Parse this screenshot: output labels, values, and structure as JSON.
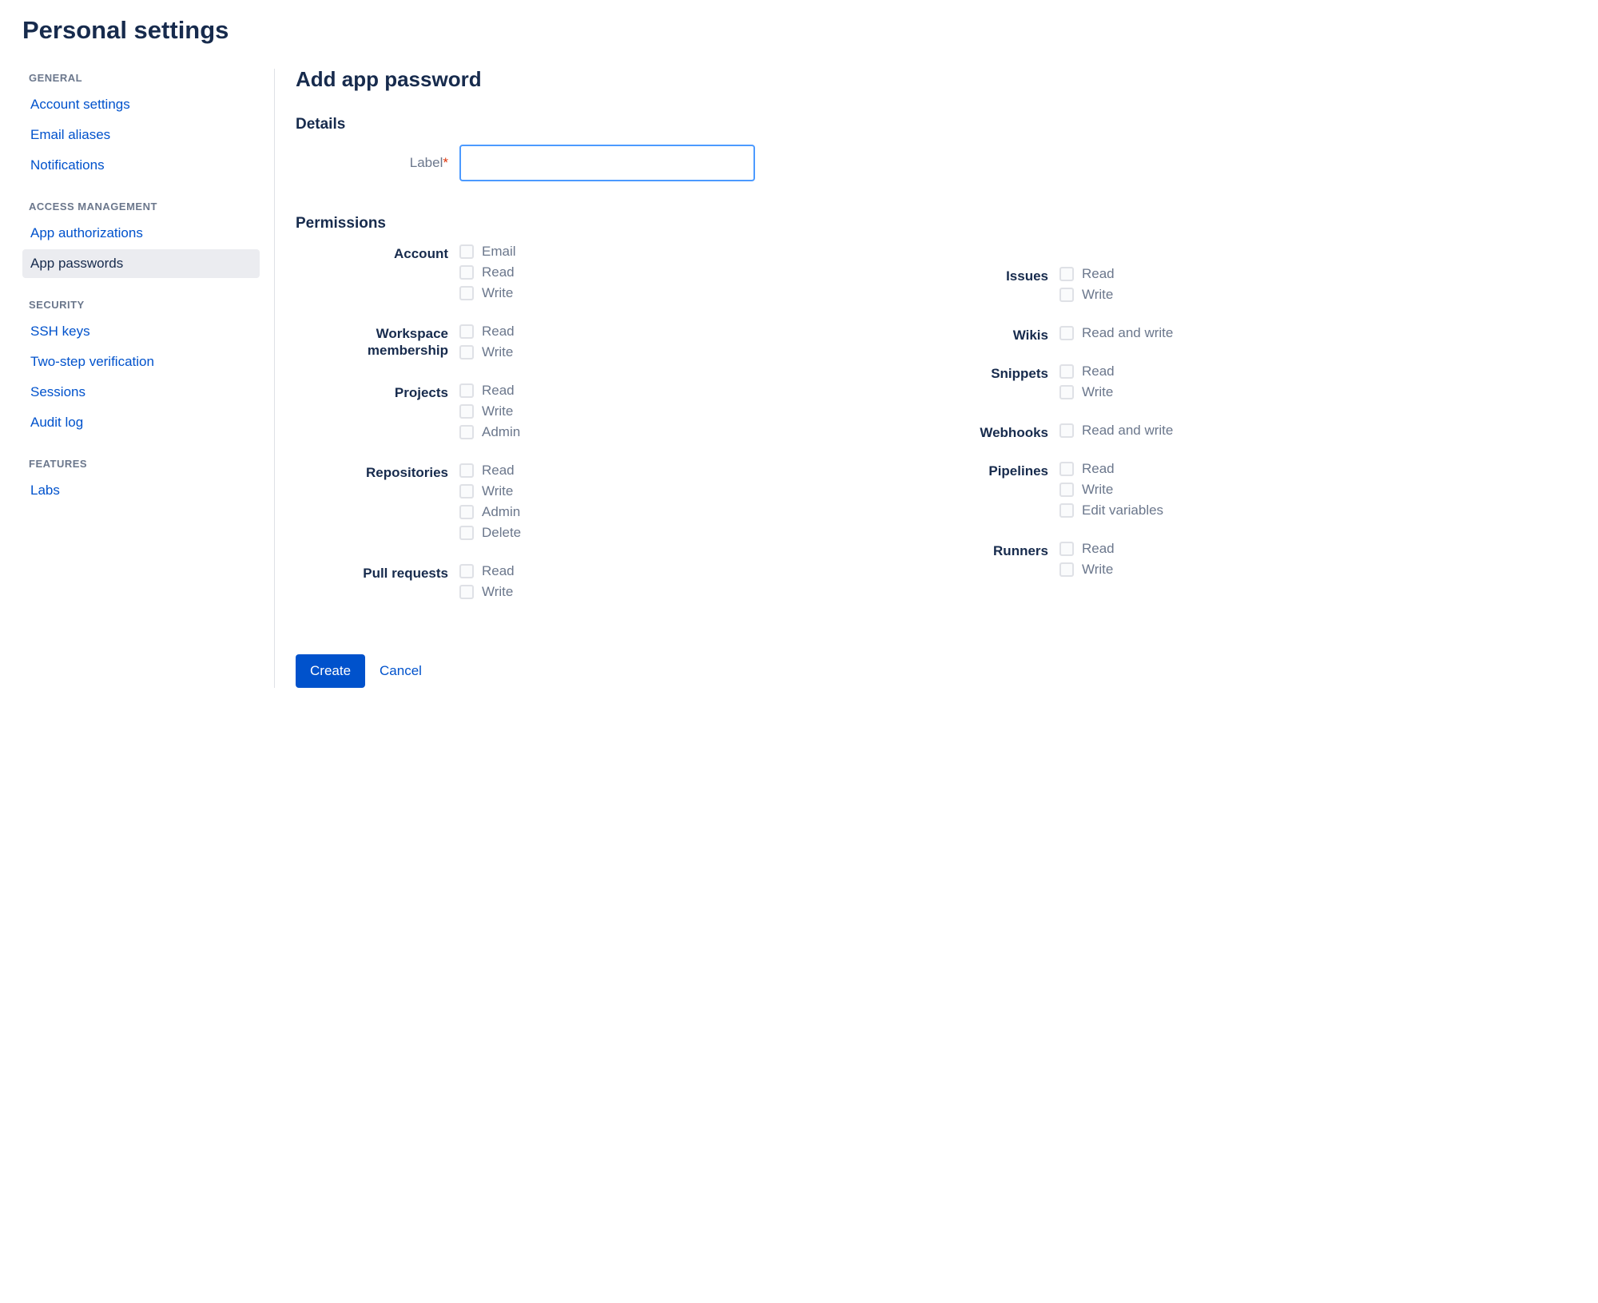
{
  "page_title": "Personal settings",
  "sidebar": {
    "groups": [
      {
        "label": "GENERAL",
        "items": [
          {
            "label": "Account settings"
          },
          {
            "label": "Email aliases"
          },
          {
            "label": "Notifications"
          }
        ]
      },
      {
        "label": "ACCESS MANAGEMENT",
        "items": [
          {
            "label": "App authorizations"
          },
          {
            "label": "App passwords",
            "active": true
          }
        ]
      },
      {
        "label": "SECURITY",
        "items": [
          {
            "label": "SSH keys"
          },
          {
            "label": "Two-step verification"
          },
          {
            "label": "Sessions"
          },
          {
            "label": "Audit log"
          }
        ]
      },
      {
        "label": "FEATURES",
        "items": [
          {
            "label": "Labs"
          }
        ]
      }
    ]
  },
  "main": {
    "title": "Add app password",
    "details_heading": "Details",
    "label_field": "Label",
    "required_mark": "*",
    "permissions_heading": "Permissions",
    "left_groups": [
      {
        "name": "Account",
        "checks": [
          "Email",
          "Read",
          "Write"
        ]
      },
      {
        "name": "Workspace membership",
        "checks": [
          "Read",
          "Write"
        ]
      },
      {
        "name": "Projects",
        "checks": [
          "Read",
          "Write",
          "Admin"
        ]
      },
      {
        "name": "Repositories",
        "checks": [
          "Read",
          "Write",
          "Admin",
          "Delete"
        ]
      },
      {
        "name": "Pull requests",
        "checks": [
          "Read",
          "Write"
        ]
      }
    ],
    "right_groups": [
      {
        "name": "Issues",
        "checks": [
          "Read",
          "Write"
        ]
      },
      {
        "name": "Wikis",
        "checks": [
          "Read and write"
        ]
      },
      {
        "name": "Snippets",
        "checks": [
          "Read",
          "Write"
        ]
      },
      {
        "name": "Webhooks",
        "checks": [
          "Read and write"
        ]
      },
      {
        "name": "Pipelines",
        "checks": [
          "Read",
          "Write",
          "Edit variables"
        ]
      },
      {
        "name": "Runners",
        "checks": [
          "Read",
          "Write"
        ]
      }
    ],
    "create_label": "Create",
    "cancel_label": "Cancel"
  }
}
